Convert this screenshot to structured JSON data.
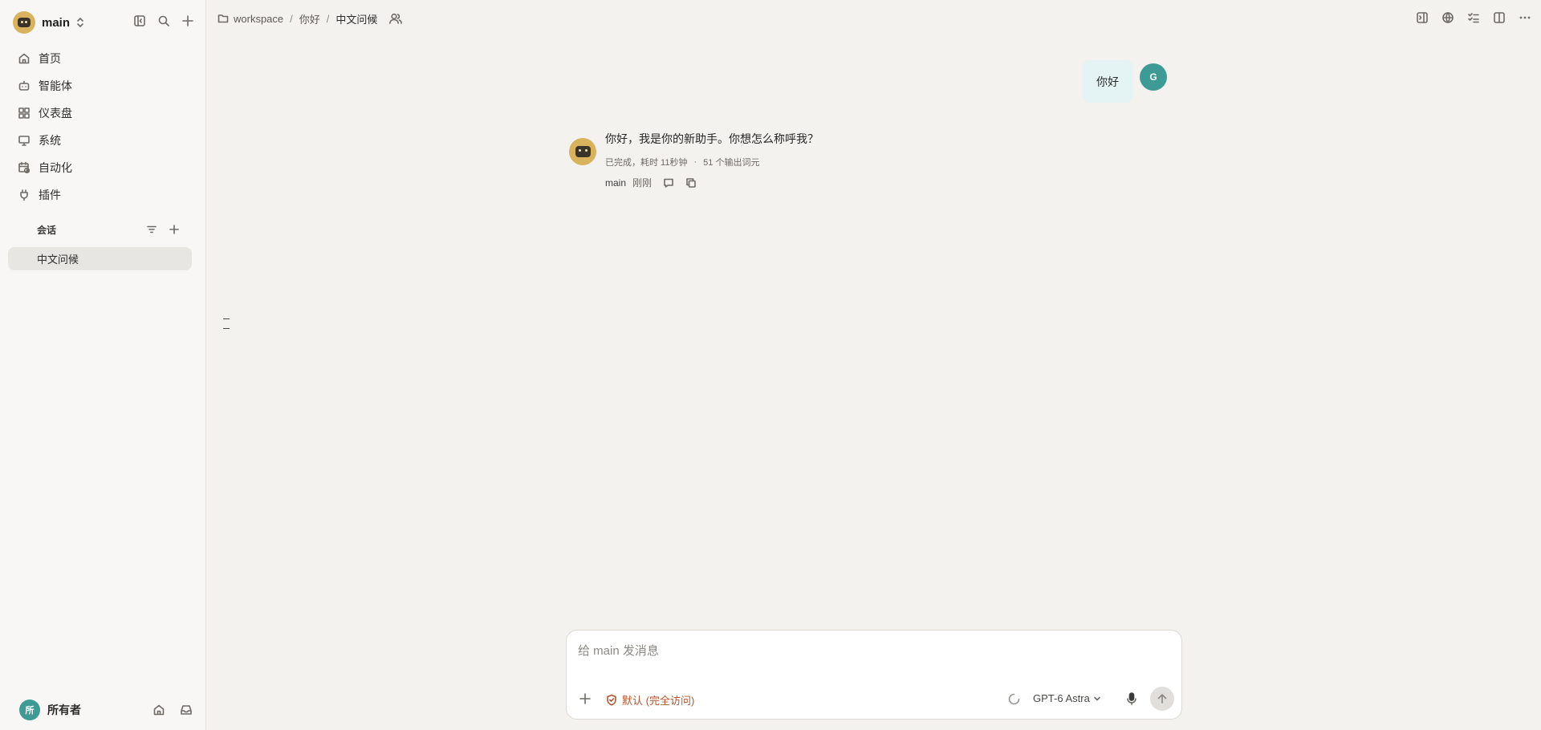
{
  "sidebar": {
    "workspace_name": "main",
    "nav": [
      {
        "label": "首页",
        "icon": "home-icon"
      },
      {
        "label": "智能体",
        "icon": "robot-icon"
      },
      {
        "label": "仪表盘",
        "icon": "dashboard-icon"
      },
      {
        "label": "系统",
        "icon": "monitor-icon"
      },
      {
        "label": "自动化",
        "icon": "calendar-clock-icon"
      },
      {
        "label": "插件",
        "icon": "plug-icon"
      }
    ],
    "section_label": "会话",
    "conversations": [
      {
        "label": "中文问候",
        "active": true
      }
    ],
    "footer": {
      "avatar_initial": "所",
      "name": "所有者"
    }
  },
  "breadcrumb": {
    "items": [
      "workspace",
      "你好",
      "中文问候"
    ]
  },
  "chat": {
    "user_message": "你好",
    "user_avatar_initial": "G",
    "assistant_message": "你好，我是你的新助手。你想怎么称呼我？",
    "assistant_status": "已完成，耗时 11秒钟",
    "assistant_tokens": "51 个输出词元",
    "assistant_name": "main",
    "assistant_time": "刚刚"
  },
  "composer": {
    "placeholder": "给 main 发消息",
    "permission_label": "默认 (完全访问)",
    "model_label": "GPT-6 Astra"
  },
  "colors": {
    "accent_teal": "#3d9a95",
    "bot_avatar": "#d9b25d",
    "permission_orange": "#b6542d"
  }
}
